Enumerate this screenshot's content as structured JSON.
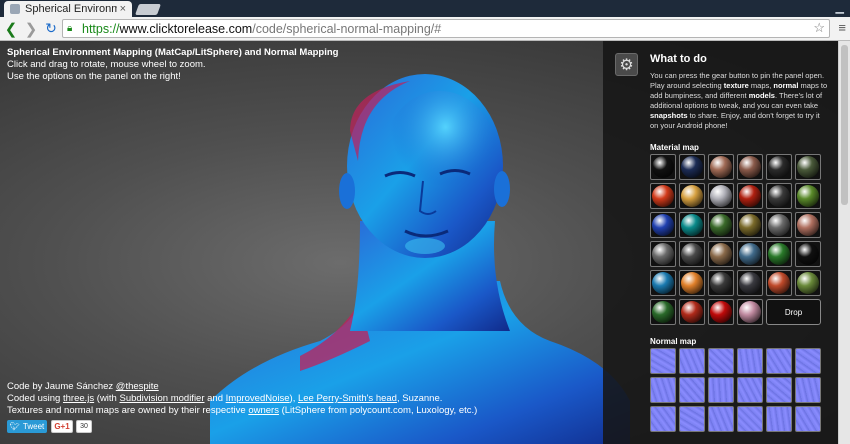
{
  "browser": {
    "tab_title": "Spherical Environme",
    "tab_close": "×",
    "url_scheme": "https://",
    "url_host": "www.clicktorelease.com",
    "url_path": "/code/spherical-normal-mapping/#",
    "back_icon": "arrow-left-icon",
    "forward_icon": "arrow-right-icon",
    "reload_icon": "reload-icon",
    "star_icon": "star-icon",
    "menu_icon": "hamburger-icon"
  },
  "intro": {
    "heading": "Spherical Environment Mapping (MatCap/LitSphere) and Normal Mapping",
    "line1": "Click and drag to rotate, mouse wheel to zoom.",
    "line2": "Use the options on the panel on the right!"
  },
  "credits": {
    "code_by": "Code by Jaume Sánchez ",
    "code_by_handle": "@thespite",
    "coded_using_prefix": "Coded using ",
    "threejs": "three.js",
    "with_prefix": " (with ",
    "subdivision": "Subdivision modifier",
    "and": " and ",
    "improved_noise": "ImprovedNoise",
    "after_noise": "), ",
    "lee_perry": "Lee Perry-Smith's head",
    "suzanne": ", Suzanne.",
    "textures_prefix": "Textures and normal maps are owned by their respective ",
    "owners": "owners",
    "textures_suffix": " (LitSphere from polycount.com, Luxology, etc.)"
  },
  "social": {
    "tweet": "Tweet",
    "gplus": "G+1",
    "count": "30"
  },
  "panel": {
    "title": "What to do",
    "desc_1": "You can press the gear button to pin the panel open. Play around selecting ",
    "desc_texture": "texture",
    "desc_2": " maps, ",
    "desc_normal": "normal",
    "desc_3": " maps to add bumpiness, and different ",
    "desc_models": "models",
    "desc_4": ". There's lot of additional options to tweak, and you can even take ",
    "desc_snapshots": "snapshots",
    "desc_5": " to share. Enjoy, and don't forget to try it on your Android phone!",
    "material_label": "Material map",
    "normal_label": "Normal map",
    "drop_label": "Drop",
    "gear_icon": "gear-icon"
  },
  "materials": [
    "#111",
    "#1c2c55",
    "#a06a55",
    "#8a5a4a",
    "#2b2b2b",
    "#4a5a3a",
    "#d23a1a",
    "#d6a040",
    "#b0b0b8",
    "#b02010",
    "#3a3a3a",
    "#5a8a2a",
    "#2040b0",
    "#0a8a8a",
    "#3a6a2a",
    "#7a6a2a",
    "#6a6a6a",
    "#b07060",
    "#6a6a6a",
    "#4a4a4a",
    "#8a6a4a",
    "#406a8a",
    "#2a7a2a",
    "#101010",
    "#1a7ab0",
    "#e0802a",
    "#3a3a3a",
    "#3a3a40",
    "#c04a2a",
    "#6a8a3a",
    "#2a6a2a",
    "#b02a1a",
    "#c00a0a",
    "#c08aa0"
  ],
  "normals_count": 18
}
